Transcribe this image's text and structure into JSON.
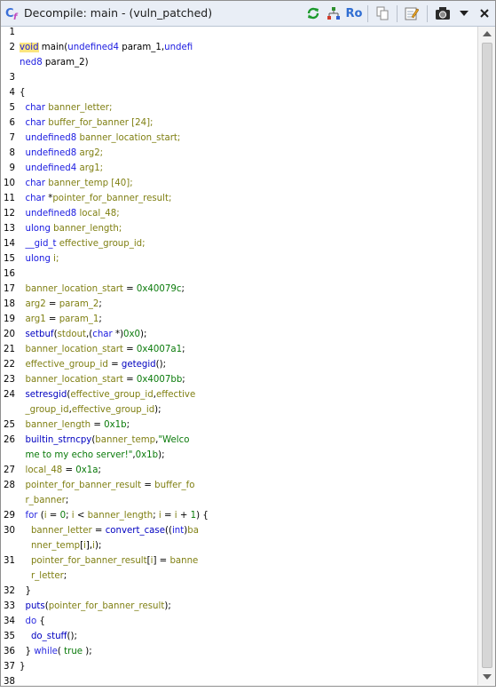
{
  "window": {
    "title": "Decompile: main -  (vuln_patched)",
    "ro_label": "Ro"
  },
  "lines": [
    {
      "n": "1",
      "t": []
    },
    {
      "n": "2",
      "t": [
        [
          "void",
          "t hl"
        ],
        [
          " main(",
          ""
        ],
        [
          "undefined4",
          "t"
        ],
        [
          " param_1,",
          ""
        ],
        [
          "undefi",
          "t"
        ]
      ]
    },
    {
      "n": "",
      "t": [
        [
          "ned8",
          "t"
        ],
        [
          " param_2)",
          ""
        ]
      ]
    },
    {
      "n": "3",
      "t": []
    },
    {
      "n": "4",
      "t": [
        [
          "{",
          ""
        ]
      ]
    },
    {
      "n": "5",
      "t": [
        [
          "  ",
          ""
        ],
        [
          "char",
          "t"
        ],
        [
          " banner_letter;",
          "v"
        ]
      ]
    },
    {
      "n": "6",
      "t": [
        [
          "  ",
          ""
        ],
        [
          "char",
          "t"
        ],
        [
          " buffer_for_banner [24];",
          "v"
        ]
      ]
    },
    {
      "n": "7",
      "t": [
        [
          "  ",
          ""
        ],
        [
          "undefined8",
          "t"
        ],
        [
          " banner_location_start;",
          "v"
        ]
      ]
    },
    {
      "n": "8",
      "t": [
        [
          "  ",
          ""
        ],
        [
          "undefined8",
          "t"
        ],
        [
          " arg2;",
          "v"
        ]
      ]
    },
    {
      "n": "9",
      "t": [
        [
          "  ",
          ""
        ],
        [
          "undefined4",
          "t"
        ],
        [
          " arg1;",
          "v"
        ]
      ]
    },
    {
      "n": "10",
      "t": [
        [
          "  ",
          ""
        ],
        [
          "char",
          "t"
        ],
        [
          " banner_temp [40];",
          "v"
        ]
      ]
    },
    {
      "n": "11",
      "t": [
        [
          "  ",
          ""
        ],
        [
          "char",
          "t"
        ],
        [
          " *",
          ""
        ],
        [
          "pointer_for_banner_result;",
          "v"
        ]
      ]
    },
    {
      "n": "12",
      "t": [
        [
          "  ",
          ""
        ],
        [
          "undefined8",
          "t"
        ],
        [
          " local_48;",
          "v"
        ]
      ]
    },
    {
      "n": "13",
      "t": [
        [
          "  ",
          ""
        ],
        [
          "ulong",
          "t"
        ],
        [
          " banner_length;",
          "v"
        ]
      ]
    },
    {
      "n": "14",
      "t": [
        [
          "  ",
          ""
        ],
        [
          "__gid_t",
          "t"
        ],
        [
          " effective_group_id;",
          "v"
        ]
      ]
    },
    {
      "n": "15",
      "t": [
        [
          "  ",
          ""
        ],
        [
          "ulong",
          "t"
        ],
        [
          " i;",
          "v"
        ]
      ]
    },
    {
      "n": "16",
      "t": []
    },
    {
      "n": "17",
      "t": [
        [
          "  ",
          ""
        ],
        [
          "banner_location_start",
          "v"
        ],
        [
          " = ",
          ""
        ],
        [
          "0x40079c",
          "c"
        ],
        [
          ";",
          ""
        ]
      ]
    },
    {
      "n": "18",
      "t": [
        [
          "  ",
          ""
        ],
        [
          "arg2",
          "v"
        ],
        [
          " = ",
          ""
        ],
        [
          "param_2",
          "v"
        ],
        [
          ";",
          ""
        ]
      ]
    },
    {
      "n": "19",
      "t": [
        [
          "  ",
          ""
        ],
        [
          "arg1",
          "v"
        ],
        [
          " = ",
          ""
        ],
        [
          "param_1",
          "v"
        ],
        [
          ";",
          ""
        ]
      ]
    },
    {
      "n": "20",
      "t": [
        [
          "  ",
          ""
        ],
        [
          "setbuf",
          "f"
        ],
        [
          "(",
          ""
        ],
        [
          "stdout",
          "v"
        ],
        [
          ",(",
          ""
        ],
        [
          "char",
          "t"
        ],
        [
          " *)",
          ""
        ],
        [
          "0x0",
          "c"
        ],
        [
          ");",
          ""
        ]
      ]
    },
    {
      "n": "21",
      "t": [
        [
          "  ",
          ""
        ],
        [
          "banner_location_start",
          "v"
        ],
        [
          " = ",
          ""
        ],
        [
          "0x4007a1",
          "c"
        ],
        [
          ";",
          ""
        ]
      ]
    },
    {
      "n": "22",
      "t": [
        [
          "  ",
          ""
        ],
        [
          "effective_group_id",
          "v"
        ],
        [
          " = ",
          ""
        ],
        [
          "getegid",
          "f"
        ],
        [
          "();",
          ""
        ]
      ]
    },
    {
      "n": "23",
      "t": [
        [
          "  ",
          ""
        ],
        [
          "banner_location_start",
          "v"
        ],
        [
          " = ",
          ""
        ],
        [
          "0x4007bb",
          "c"
        ],
        [
          ";",
          ""
        ]
      ]
    },
    {
      "n": "24",
      "t": [
        [
          "  ",
          ""
        ],
        [
          "setresgid",
          "f"
        ],
        [
          "(",
          ""
        ],
        [
          "effective_group_id",
          "v"
        ],
        [
          ",",
          ""
        ],
        [
          "effective",
          "v"
        ]
      ]
    },
    {
      "n": "",
      "t": [
        [
          "  ",
          ""
        ],
        [
          "_group_id",
          "v"
        ],
        [
          ",",
          ""
        ],
        [
          "effective_group_id",
          "v"
        ],
        [
          ");",
          ""
        ]
      ]
    },
    {
      "n": "25",
      "t": [
        [
          "  ",
          ""
        ],
        [
          "banner_length",
          "v"
        ],
        [
          " = ",
          ""
        ],
        [
          "0x1b",
          "c"
        ],
        [
          ";",
          ""
        ]
      ]
    },
    {
      "n": "26",
      "t": [
        [
          "  ",
          ""
        ],
        [
          "builtin_strncpy",
          "f"
        ],
        [
          "(",
          ""
        ],
        [
          "banner_temp",
          "v"
        ],
        [
          ",",
          ""
        ],
        [
          "\"Welco",
          "s"
        ]
      ]
    },
    {
      "n": "",
      "t": [
        [
          "  ",
          ""
        ],
        [
          "me to my echo server!\"",
          "s"
        ],
        [
          ",",
          ""
        ],
        [
          "0x1b",
          "c"
        ],
        [
          ");",
          ""
        ]
      ]
    },
    {
      "n": "27",
      "t": [
        [
          "  ",
          ""
        ],
        [
          "local_48",
          "v"
        ],
        [
          " = ",
          ""
        ],
        [
          "0x1a",
          "c"
        ],
        [
          ";",
          ""
        ]
      ]
    },
    {
      "n": "28",
      "t": [
        [
          "  ",
          ""
        ],
        [
          "pointer_for_banner_result",
          "v"
        ],
        [
          " = ",
          ""
        ],
        [
          "buffer_fo",
          "v"
        ]
      ]
    },
    {
      "n": "",
      "t": [
        [
          "  ",
          ""
        ],
        [
          "r_banner",
          "v"
        ],
        [
          ";",
          ""
        ]
      ]
    },
    {
      "n": "29",
      "t": [
        [
          "  ",
          ""
        ],
        [
          "for",
          "kw"
        ],
        [
          " (",
          ""
        ],
        [
          "i",
          "v"
        ],
        [
          " = ",
          ""
        ],
        [
          "0",
          "c"
        ],
        [
          "; ",
          ""
        ],
        [
          "i",
          "v"
        ],
        [
          " < ",
          ""
        ],
        [
          "banner_length",
          "v"
        ],
        [
          "; ",
          ""
        ],
        [
          "i",
          "v"
        ],
        [
          " = ",
          ""
        ],
        [
          "i",
          "v"
        ],
        [
          " + ",
          ""
        ],
        [
          "1",
          "c"
        ],
        [
          ") {",
          ""
        ]
      ]
    },
    {
      "n": "30",
      "t": [
        [
          "    ",
          ""
        ],
        [
          "banner_letter",
          "v"
        ],
        [
          " = ",
          ""
        ],
        [
          "convert_case",
          "f"
        ],
        [
          "((",
          ""
        ],
        [
          "int",
          "t"
        ],
        [
          ")",
          ""
        ],
        [
          "ba",
          "v"
        ]
      ]
    },
    {
      "n": "",
      "t": [
        [
          "    ",
          ""
        ],
        [
          "nner_temp",
          "v"
        ],
        [
          "[",
          ""
        ],
        [
          "i",
          "v"
        ],
        [
          "],",
          ""
        ],
        [
          "i",
          "v"
        ],
        [
          ");",
          ""
        ]
      ]
    },
    {
      "n": "31",
      "t": [
        [
          "    ",
          ""
        ],
        [
          "pointer_for_banner_result",
          "v"
        ],
        [
          "[",
          ""
        ],
        [
          "i",
          "v"
        ],
        [
          "] = ",
          ""
        ],
        [
          "banne",
          "v"
        ]
      ]
    },
    {
      "n": "",
      "t": [
        [
          "    ",
          ""
        ],
        [
          "r_letter",
          "v"
        ],
        [
          ";",
          ""
        ]
      ]
    },
    {
      "n": "32",
      "t": [
        [
          "  }",
          ""
        ]
      ]
    },
    {
      "n": "33",
      "t": [
        [
          "  ",
          ""
        ],
        [
          "puts",
          "f"
        ],
        [
          "(",
          ""
        ],
        [
          "pointer_for_banner_result",
          "v"
        ],
        [
          ");",
          ""
        ]
      ]
    },
    {
      "n": "34",
      "t": [
        [
          "  ",
          ""
        ],
        [
          "do",
          "kw"
        ],
        [
          " {",
          ""
        ]
      ]
    },
    {
      "n": "35",
      "t": [
        [
          "    ",
          ""
        ],
        [
          "do_stuff",
          "f"
        ],
        [
          "();",
          ""
        ]
      ]
    },
    {
      "n": "36",
      "t": [
        [
          "  } ",
          ""
        ],
        [
          "while",
          "kw"
        ],
        [
          "( ",
          ""
        ],
        [
          "true",
          "c"
        ],
        [
          " );",
          ""
        ]
      ]
    },
    {
      "n": "37",
      "t": [
        [
          "}",
          ""
        ]
      ]
    },
    {
      "n": "38",
      "t": []
    }
  ]
}
